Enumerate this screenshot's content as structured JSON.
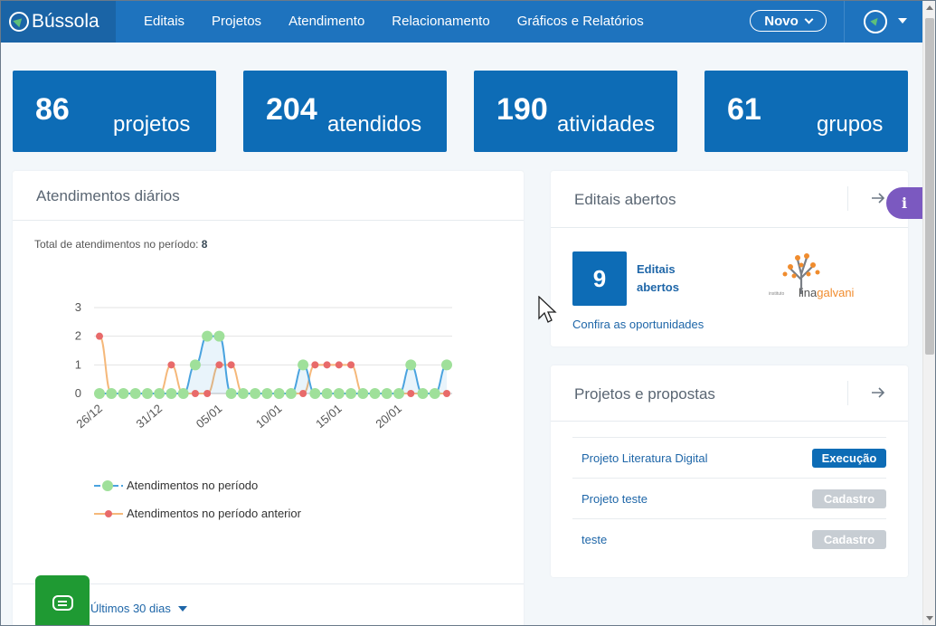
{
  "nav": {
    "brand": "Bússola",
    "links": [
      "Editais",
      "Projetos",
      "Atendimento",
      "Relacionamento",
      "Gráficos e Relatórios"
    ],
    "novo_label": "Novo"
  },
  "stats": [
    {
      "value": "86",
      "label": "projetos"
    },
    {
      "value": "204",
      "label": "atendidos"
    },
    {
      "value": "190",
      "label": "atividades"
    },
    {
      "value": "61",
      "label": "grupos"
    }
  ],
  "atendimentos": {
    "title": "Atendimentos diários",
    "subtitle_prefix": "Total de atendimentos no período: ",
    "subtitle_total": "8",
    "period_label": "Últimos 30 dias"
  },
  "chart_data": {
    "type": "line",
    "x": [
      "26/12",
      "27/12",
      "28/12",
      "29/12",
      "30/12",
      "31/12",
      "01/01",
      "02/01",
      "03/01",
      "04/01",
      "05/01",
      "06/01",
      "07/01",
      "08/01",
      "09/01",
      "10/01",
      "11/01",
      "12/01",
      "13/01",
      "14/01",
      "15/01",
      "16/01",
      "17/01",
      "18/01",
      "19/01",
      "20/01",
      "21/01",
      "22/01",
      "23/01",
      "24/01"
    ],
    "tick_labels": [
      "26/12",
      "31/12",
      "05/01",
      "10/01",
      "15/01",
      "20/01"
    ],
    "series": [
      {
        "name": "Atendimentos no período",
        "color": "#4aa3df",
        "marker_color": "#9fe09a",
        "values": [
          0,
          0,
          0,
          0,
          0,
          0,
          0,
          0,
          1,
          2,
          2,
          0,
          0,
          0,
          0,
          0,
          0,
          1,
          0,
          0,
          0,
          0,
          0,
          0,
          0,
          0,
          1,
          0,
          0,
          1
        ]
      },
      {
        "name": "Atendimentos no período anterior",
        "color": "#f5b87a",
        "marker_color": "#e86a6a",
        "values": [
          2,
          0,
          0,
          0,
          0,
          0,
          1,
          0,
          0,
          0,
          1,
          1,
          0,
          0,
          0,
          0,
          0,
          0,
          1,
          1,
          1,
          1,
          0,
          0,
          0,
          0,
          0,
          0,
          0,
          0
        ]
      }
    ],
    "y_ticks": [
      0,
      1,
      2,
      3
    ],
    "ylim": [
      0,
      3
    ],
    "grid": true,
    "legend": "bottom-left"
  },
  "editais": {
    "title": "Editais abertos",
    "count": "9",
    "label": "Editais abertos",
    "link": "Confira as oportunidades",
    "logo_small": "instituto",
    "logo_text_1": "lina",
    "logo_text_2": "galvani"
  },
  "projetos": {
    "title": "Projetos e propostas",
    "rows": [
      {
        "name": "Projeto Literatura Digital",
        "status": "Execução",
        "color": "#0d6cb6"
      },
      {
        "name": "Projeto teste",
        "status": "Cadastro",
        "color": "#c7cdd3"
      },
      {
        "name": "teste",
        "status": "Cadastro",
        "color": "#c7cdd3"
      }
    ]
  },
  "fabs": {
    "info": "i"
  }
}
